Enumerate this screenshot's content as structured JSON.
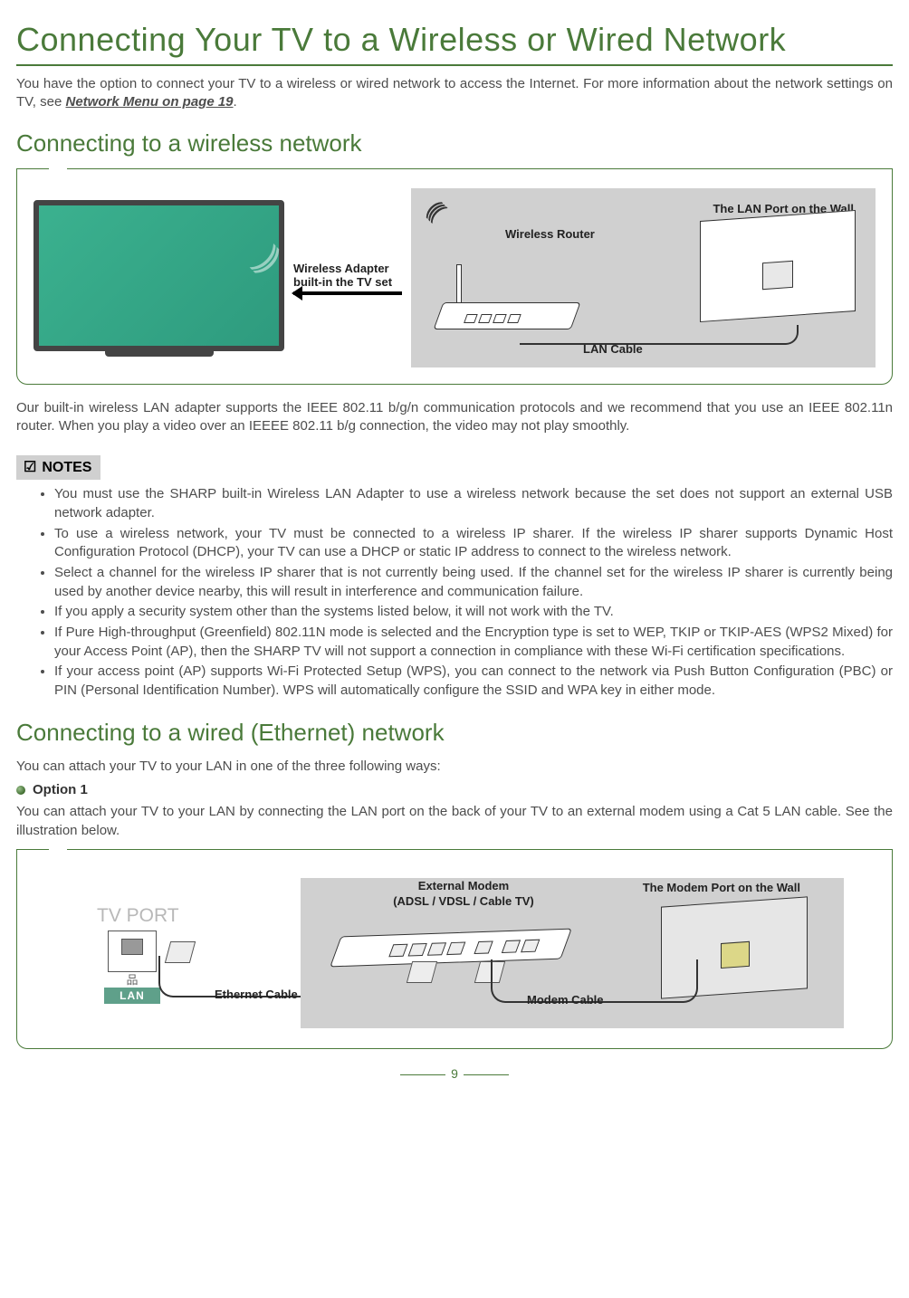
{
  "page": {
    "title": "Connecting Your TV to a Wireless or Wired Network",
    "intro_a": "You have the option to connect your TV to a wireless or wired network to access the Internet. For more information about the network settings on TV, see ",
    "intro_link": "Network Menu on page 19",
    "intro_b": ".",
    "page_number": "9"
  },
  "wireless": {
    "heading": "Connecting to a wireless network",
    "diagram": {
      "adapter_label_1": "Wireless Adapter",
      "adapter_label_2": "built-in the TV set",
      "router_label": "Wireless Router",
      "wall_label": "The LAN Port on the Wall",
      "cable_label": "LAN Cable"
    },
    "body": "Our built-in wireless LAN adapter supports the IEEE 802.11 b/g/n communication protocols and we recommend that you use an IEEE 802.11n router. When you play a video over an IEEEE 802.11 b/g connection, the video may not play smoothly.",
    "notes_title": "NOTES",
    "notes": [
      "You must use the SHARP built-in Wireless LAN Adapter to use a wireless network because the set does not support an external USB network adapter.",
      "To use a wireless network, your TV must be connected to a wireless IP sharer. If the wireless IP sharer supports Dynamic Host Configuration Protocol (DHCP), your TV can use a DHCP or static IP address to connect to the wireless network.",
      "Select a channel for the wireless IP sharer that is not currently being used. If the channel set for the wireless IP sharer is currently being used by another device nearby, this will result in interference and communication failure.",
      "If you apply a security system other than the systems listed below, it will not work with the TV.",
      "If Pure High-throughput (Greenfield) 802.11N mode is selected and the Encryption type is set to WEP, TKIP or TKIP-AES (WPS2 Mixed) for your Access Point (AP), then the SHARP TV will not support a connection in compliance with these Wi-Fi certification specifications.",
      "If your access point (AP) supports Wi-Fi Protected Setup (WPS), you can connect to the network via Push Button Configuration (PBC) or PIN (Personal Identification Number). WPS will automatically configure the SSID and WPA key in either mode."
    ]
  },
  "wired": {
    "heading": "Connecting to a wired (Ethernet) network",
    "intro": "You can attach your TV to your LAN in one of the three following ways:",
    "option_label": "Option 1",
    "option_body": "You can attach your TV to your LAN by connecting the LAN port on the back of your TV to an external modem using a Cat 5 LAN cable. See the illustration below.",
    "diagram": {
      "tv_port": "TV PORT",
      "lan_label": "LAN",
      "eth_cable": "Ethernet Cable",
      "modem_label_1": "External Modem",
      "modem_label_2": "(ADSL / VDSL / Cable TV)",
      "modem_cable": "Modem Cable",
      "wall_label": "The Modem Port on the Wall"
    }
  }
}
